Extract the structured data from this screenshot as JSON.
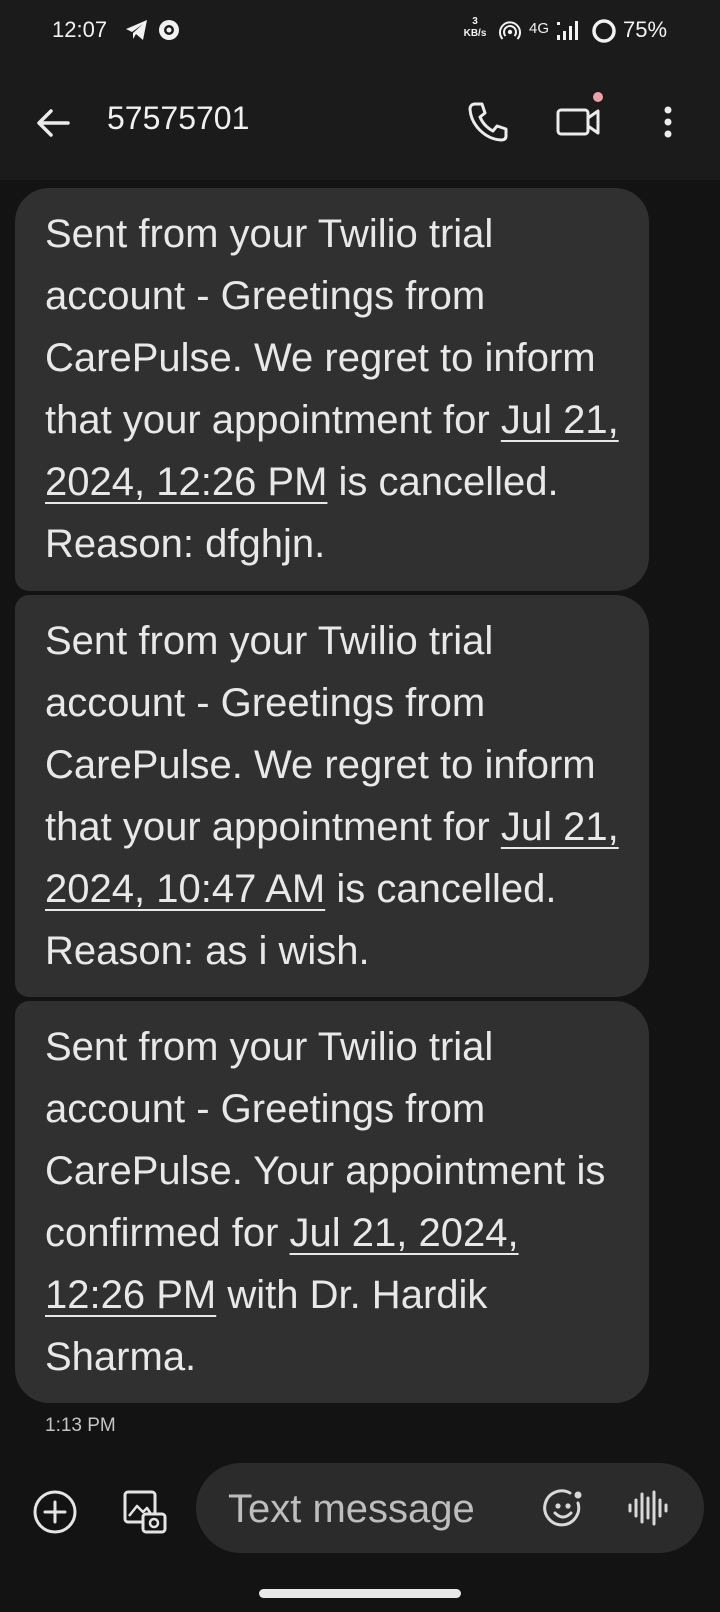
{
  "status_bar": {
    "time": "12:07",
    "speed_value": "3",
    "speed_unit": "KB/s",
    "network": "4G",
    "battery": "75%"
  },
  "header": {
    "contact_name": "57575701",
    "icons": [
      "back-arrow-icon",
      "phone-icon",
      "video-call-icon",
      "more-vert-icon"
    ]
  },
  "messages": [
    {
      "text_before": "Sent from your Twilio trial account - Greetings from CarePulse. We regret to inform that your appointment for ",
      "datetime": "Jul 21, 2024, 12:26 PM",
      "text_after": " is cancelled. Reason:  dfghjn."
    },
    {
      "text_before": "Sent from your Twilio trial account - Greetings from CarePulse. We regret to inform that your appointment for ",
      "datetime": "Jul 21, 2024, 10:47 AM",
      "text_after": " is cancelled. Reason:  as i wish."
    },
    {
      "text_before": "Sent from your Twilio trial account - Greetings from CarePulse. Your appointment is confirmed for ",
      "datetime": "Jul 21, 2024, 12:26 PM",
      "text_after": " with Dr. Hardik Sharma."
    }
  ],
  "timestamp": "1:13 PM",
  "compose": {
    "placeholder": "Text message"
  },
  "colors": {
    "background": "#131313",
    "bar": "#1b1b1b",
    "bubble": "#303030",
    "notification_dot": "#f0a0a4"
  }
}
